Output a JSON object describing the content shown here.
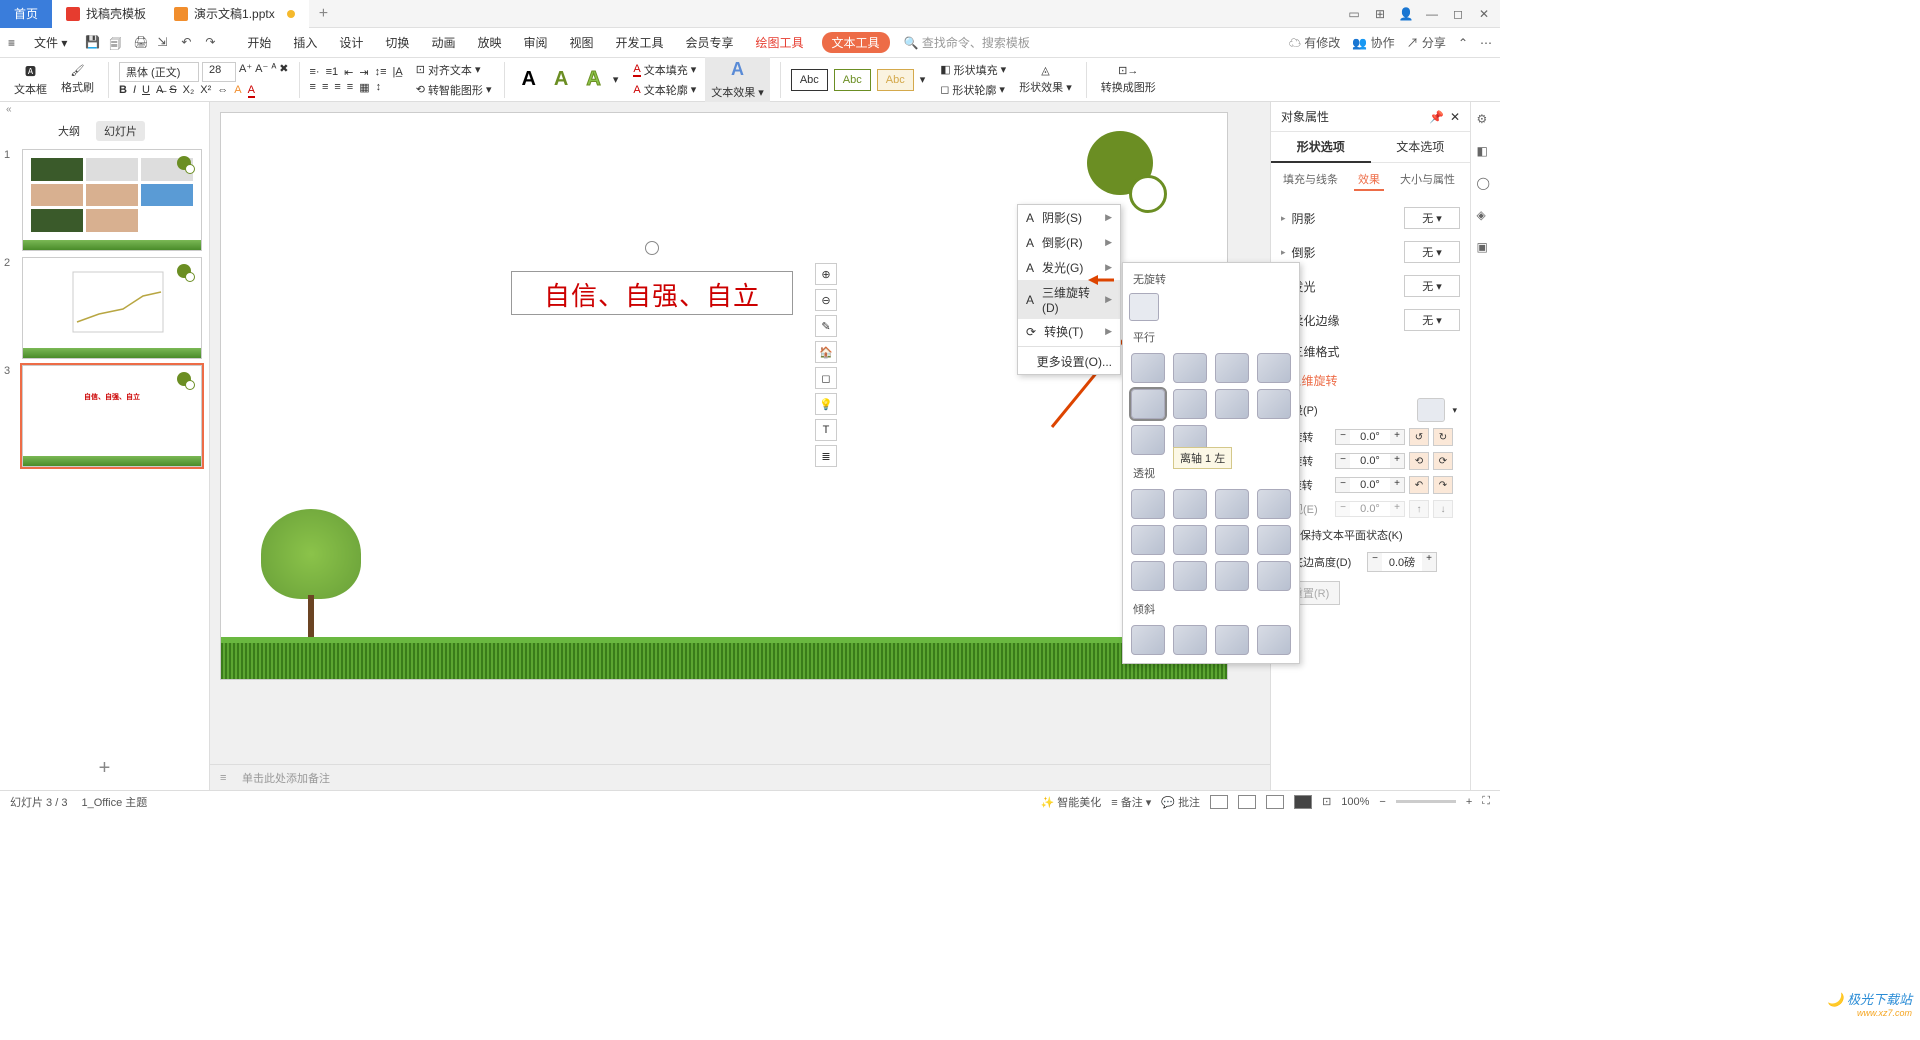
{
  "titlebar": {
    "home": "首页",
    "template_tab": "找稿壳模板",
    "doc_tab": "演示文稿1.pptx",
    "add": "+"
  },
  "menubar": {
    "file": "文件",
    "tabs": [
      "开始",
      "插入",
      "设计",
      "切换",
      "动画",
      "放映",
      "审阅",
      "视图",
      "开发工具",
      "会员专享"
    ],
    "draw_tools": "绘图工具",
    "text_tools": "文本工具",
    "search_placeholder": "查找命令、搜索模板",
    "has_change": "有修改",
    "collab": "协作",
    "share": "分享"
  },
  "ribbon": {
    "textbox": "文本框",
    "format_painter": "格式刷",
    "font_name": "黑体 (正文)",
    "font_size": "28",
    "align_text": "对齐文本",
    "to_smartart": "转智能图形",
    "text_fill": "文本填充",
    "text_outline": "文本轮廓",
    "text_effect": "文本效果",
    "abc": "Abc",
    "shape_fill": "形状填充",
    "shape_outline": "形状轮廓",
    "shape_effect": "形状效果",
    "to_shape": "转换成图形"
  },
  "slides": {
    "outline": "大纲",
    "slides": "幻灯片",
    "collapse": "«"
  },
  "dropdown": {
    "shadow": "阴影(S)",
    "reflection": "倒影(R)",
    "glow": "发光(G)",
    "rotation3d": "三维旋转(D)",
    "transform": "转换(T)",
    "more": "更多设置(O)..."
  },
  "submenu": {
    "no_rotation": "无旋转",
    "parallel": "平行",
    "perspective": "透视",
    "oblique": "倾斜",
    "tooltip": "离轴 1 左"
  },
  "canvas": {
    "text": "自信、自强、自立",
    "notes_placeholder": "单击此处添加备注"
  },
  "props": {
    "title": "对象属性",
    "shape_opts": "形状选项",
    "text_opts": "文本选项",
    "fill_line": "填充与线条",
    "effects": "效果",
    "size_props": "大小与属性",
    "shadow": "阴影",
    "reflection": "倒影",
    "glow": "发光",
    "soft_edge": "柔化边缘",
    "format3d": "三维格式",
    "rotation3d": "三维旋转",
    "preset": "预设(P)",
    "x_rot": "X 旋转",
    "y_rot": "Y 旋转",
    "z_rot": "Z 旋转",
    "perspective": "透视(E)",
    "keep_flat": "保持文本平面状态(K)",
    "distance": "距底边高度(D)",
    "reset": "重置(R)",
    "none": "无",
    "deg": "0.0°",
    "dist_val": "0.0磅"
  },
  "status": {
    "slide_pos": "幻灯片 3 / 3",
    "theme": "1_Office 主题",
    "beautify": "智能美化",
    "notes": "备注",
    "comments": "批注",
    "zoom": "100%"
  },
  "watermark": {
    "main": "极光下载站",
    "sub": "www.xz7.com"
  }
}
